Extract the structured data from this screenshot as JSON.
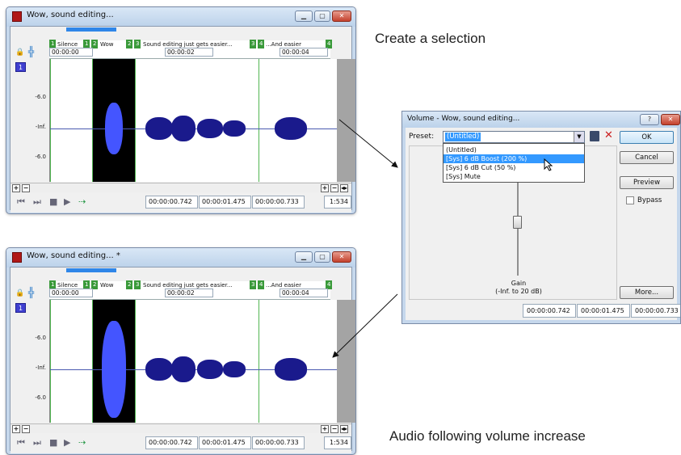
{
  "windows": [
    {
      "title": "Wow, sound editing...",
      "caption": "Create a selection",
      "boost": false
    },
    {
      "title": "Wow, sound editing... *",
      "caption": "Audio following volume increase",
      "boost": true
    }
  ],
  "ruler": {
    "markers": [
      {
        "num": "1",
        "label": "Silence"
      },
      {
        "num": "1",
        "label": ""
      },
      {
        "num": "2",
        "label": "Wow"
      },
      {
        "num": "2",
        "label": ""
      },
      {
        "num": "3",
        "label": "Sound editing just gets easier..."
      },
      {
        "num": "3",
        "label": ""
      },
      {
        "num": "4",
        "label": "...And easier"
      },
      {
        "num": "4",
        "label": ""
      }
    ],
    "times": [
      "00:00:00",
      "00:00:02",
      "00:00:04"
    ]
  },
  "track": {
    "number": "1",
    "db_labels": [
      "-6.0",
      "-Inf.",
      "-6.0"
    ]
  },
  "transport": {
    "sel_start": "00:00:00.742",
    "sel_end": "00:00:01.475",
    "sel_length": "00:00:00.733",
    "zoom": "1:534"
  },
  "dialog": {
    "title": "Volume - Wow, sound editing...",
    "help": "?",
    "preset_label": "Preset:",
    "preset_value": "(Untitled)",
    "preset_options": [
      "(Untitled)",
      "[Sys] 6 dB Boost (200 %)",
      "[Sys] 6 dB Cut (50 %)",
      "[Sys] Mute"
    ],
    "highlighted_option": 1,
    "ok": "OK",
    "cancel": "Cancel",
    "preview": "Preview",
    "bypass": "Bypass",
    "more": "More...",
    "gain_label": "Gain",
    "gain_range": "(-Inf. to 20 dB)",
    "status": [
      "00:00:00.742",
      "00:00:01.475",
      "00:00:00.733"
    ]
  },
  "colors": {
    "waveform": "#3a5bff",
    "waveform_dark": "#1a1a8c",
    "selection_bg": "#000000",
    "marker": "#3a9a3a",
    "accent_blue": "#2f86e8"
  }
}
